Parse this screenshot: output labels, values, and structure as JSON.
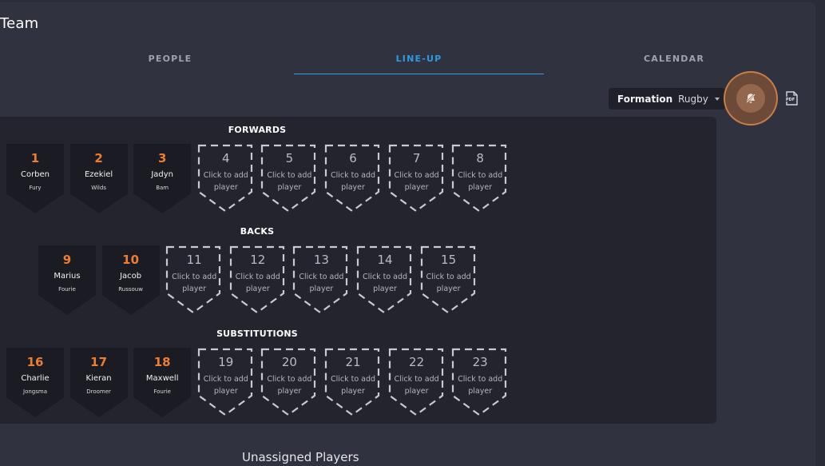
{
  "page": {
    "title": "Team"
  },
  "tabs": [
    {
      "label": "PEOPLE",
      "active": false
    },
    {
      "label": "LINE-UP",
      "active": true
    },
    {
      "label": "CALENDAR",
      "active": false
    }
  ],
  "formation": {
    "label": "Formation",
    "value": "Rugby"
  },
  "toolbar": {
    "pdf_icon": "pdf-icon",
    "bell_icon": "bell-icon"
  },
  "sections": {
    "forwards": {
      "title": "FORWARDS",
      "slots": [
        {
          "number": "1",
          "first": "Corben",
          "last": "Fury"
        },
        {
          "number": "2",
          "first": "Ezekiel",
          "last": "Wilds"
        },
        {
          "number": "3",
          "first": "Jadyn",
          "last": "Bam"
        },
        {
          "number": "4",
          "add1": "Click to add",
          "add2": "player"
        },
        {
          "number": "5",
          "add1": "Click to add",
          "add2": "player"
        },
        {
          "number": "6",
          "add1": "Click to add",
          "add2": "player"
        },
        {
          "number": "7",
          "add1": "Click to add",
          "add2": "player"
        },
        {
          "number": "8",
          "add1": "Click to add",
          "add2": "player"
        }
      ]
    },
    "backs": {
      "title": "BACKS",
      "slots": [
        {
          "number": "9",
          "first": "Marius",
          "last": "Fourie"
        },
        {
          "number": "10",
          "first": "Jacob",
          "last": "Russouw"
        },
        {
          "number": "11",
          "add1": "Click to add",
          "add2": "player"
        },
        {
          "number": "12",
          "add1": "Click to add",
          "add2": "player"
        },
        {
          "number": "13",
          "add1": "Click to add",
          "add2": "player"
        },
        {
          "number": "14",
          "add1": "Click to add",
          "add2": "player"
        },
        {
          "number": "15",
          "add1": "Click to add",
          "add2": "player"
        }
      ]
    },
    "subs": {
      "title": "SUBSTITUTIONS",
      "slots": [
        {
          "number": "16",
          "first": "Charlie",
          "last": "Jongsma"
        },
        {
          "number": "17",
          "first": "Kieran",
          "last": "Droomer"
        },
        {
          "number": "18",
          "first": "Maxwell",
          "last": "Fourie"
        },
        {
          "number": "19",
          "add1": "Click to add",
          "add2": "player"
        },
        {
          "number": "20",
          "add1": "Click to add",
          "add2": "player"
        },
        {
          "number": "21",
          "add1": "Click to add",
          "add2": "player"
        },
        {
          "number": "22",
          "add1": "Click to add",
          "add2": "player"
        },
        {
          "number": "23",
          "add1": "Click to add",
          "add2": "player"
        }
      ]
    }
  },
  "unassigned": {
    "title": "Unassigned Players"
  }
}
